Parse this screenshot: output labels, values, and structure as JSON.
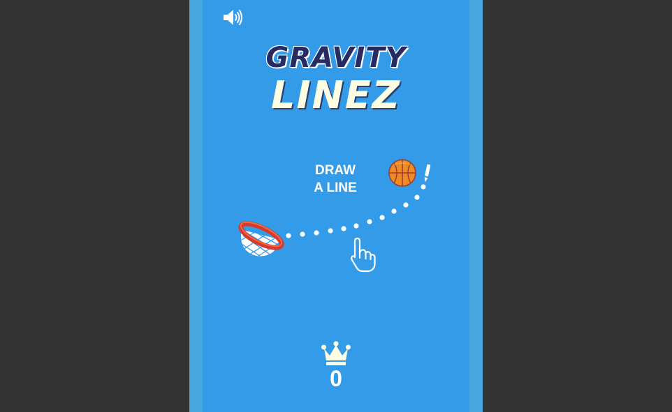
{
  "game": {
    "title_line1": "GRAVITY",
    "title_line2": "LINEZ",
    "instruction_line1": "DRAW",
    "instruction_line2": "A LINE",
    "best_score": "0"
  },
  "controls": {
    "sound": "speaker-on-icon"
  },
  "colors": {
    "outer_background": "#333333",
    "frame": "#47a6dd",
    "stage": "#339be8",
    "title_primary": "#262b63",
    "title_secondary": "#fffde3",
    "ball": "#f08a24",
    "hoop": "#d63a2a"
  }
}
